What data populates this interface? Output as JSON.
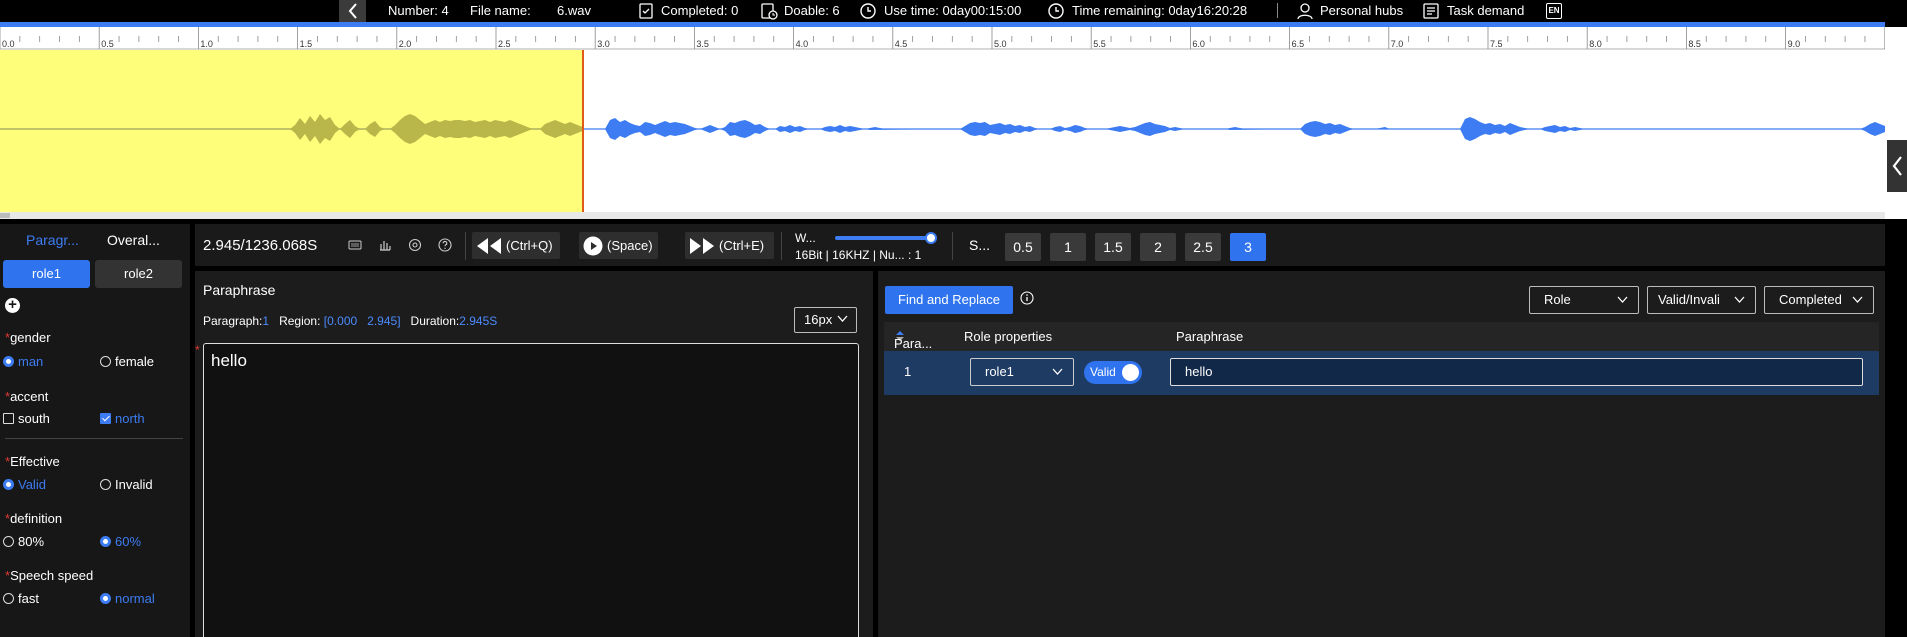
{
  "topbar": {
    "number": "Number: 4",
    "file_name_label": "File name:",
    "file_name": "6.wav",
    "completed": "Completed: 0",
    "doable": "Doable: 6",
    "use_time": "Use time: 0day00:15:00",
    "time_remaining": "Time remaining: 0day16:20:28",
    "personal_hubs": "Personal hubs",
    "task_demand": "Task demand",
    "lang": "EN"
  },
  "ruler": {
    "ticks": [
      "0.0",
      "0.5",
      "1.0",
      "1.5",
      "2.0",
      "2.5",
      "3.0",
      "3.5",
      "4.0",
      "4.5",
      "5.0",
      "5.5",
      "6.0",
      "6.5",
      "7.0",
      "7.5",
      "8.0",
      "8.5",
      "9.0"
    ]
  },
  "waveform": {
    "selection_start_s": 0.0,
    "selection_end_s": 2.945,
    "colors": {
      "selection": "#fffe7a",
      "wave_selected": "#b9b64a",
      "wave": "#3d7cf2",
      "cursor": "#e05a1a"
    }
  },
  "left_panel": {
    "tabs": [
      "Paragr...",
      "Overal..."
    ],
    "roles": [
      "role1",
      "role2"
    ],
    "groups": {
      "gender": {
        "label": "gender",
        "options": [
          "man",
          "female"
        ],
        "selected": "man"
      },
      "accent": {
        "label": "accent",
        "options": [
          "south",
          "north"
        ],
        "selected": "north"
      },
      "effective": {
        "label": "Effective",
        "options": [
          "Valid",
          "Invalid"
        ],
        "selected": "Valid"
      },
      "definition": {
        "label": "definition",
        "options": [
          "80%",
          "60%"
        ],
        "selected": "60%"
      },
      "speech_speed": {
        "label": "Speech speed",
        "options": [
          "fast",
          "normal"
        ],
        "selected": "normal"
      }
    }
  },
  "controls": {
    "time": "2.945/1236.068S",
    "back_shortcut": "(Ctrl+Q)",
    "play_shortcut": "(Space)",
    "forward_shortcut": "(Ctrl+E)",
    "wave_label": "W...",
    "audio_info": "16Bit | 16KHZ | Nu... : 1",
    "wave_slider_value": 1.0,
    "speed_label": "S...",
    "speeds": [
      "0.5",
      "1",
      "1.5",
      "2",
      "2.5",
      "3"
    ],
    "speed_selected": "3"
  },
  "editor": {
    "title": "Paraphrase",
    "paragraph_label": "Paragraph:",
    "paragraph_value": "1",
    "region_label": "Region:",
    "region_value": "[0.000   2.945]",
    "duration_label": "Duration:",
    "duration_value": "2.945S",
    "font_size": "16px",
    "text": "hello"
  },
  "right_panel": {
    "find_replace": "Find and Replace",
    "filters": [
      "Role",
      "Valid/Invali",
      "Completed"
    ],
    "columns": {
      "para": "Para...",
      "role_props": "Role properties",
      "paraphrase": "Paraphrase"
    },
    "rows": [
      {
        "para": "1",
        "role": "role1",
        "valid_label": "Valid",
        "paraphrase": "hello"
      }
    ]
  }
}
